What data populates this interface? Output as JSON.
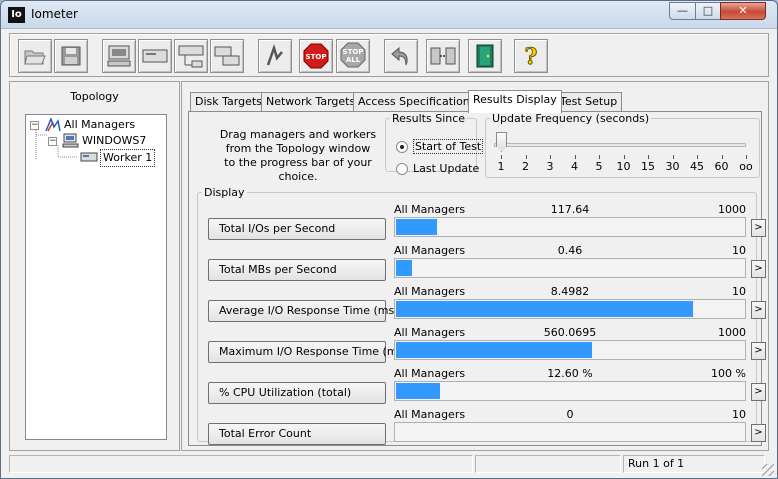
{
  "window": {
    "app_icon": "Io",
    "title": "Iometer",
    "controls": {
      "min": "—",
      "max": "□",
      "close": "✕"
    }
  },
  "toolbar": {
    "buttons": [
      {
        "name": "open-config-button",
        "icon": "folder-open-icon"
      },
      {
        "name": "save-config-button",
        "icon": "floppy-disk-icon"
      },
      {
        "name": "start-new-manager-button",
        "icon": "computer-icon"
      },
      {
        "name": "start-disk-worker-button",
        "icon": "disk-worker-icon"
      },
      {
        "name": "start-network-worker-button",
        "icon": "network-worker-icon"
      },
      {
        "name": "duplicate-worker-button",
        "icon": "duplicate-worker-icon"
      },
      {
        "name": "start-tests-button",
        "icon": "start-flag-icon"
      },
      {
        "name": "stop-button",
        "icon": "stop-sign-icon"
      },
      {
        "name": "stop-all-button",
        "icon": "stop-all-icon"
      },
      {
        "name": "reset-workers-button",
        "icon": "undo-arrow-icon"
      },
      {
        "name": "disconnect-manager-button",
        "icon": "disconnect-icon"
      },
      {
        "name": "exit-button",
        "icon": "exit-door-icon"
      },
      {
        "name": "about-button",
        "icon": "question-mark-icon"
      }
    ],
    "stop_text": "STOP",
    "stop_all_text_top": "STOP",
    "stop_all_text_bottom": "ALL",
    "help_text": "?"
  },
  "topology": {
    "header": "Topology",
    "items": [
      {
        "label": "All Managers",
        "expander": "−"
      },
      {
        "label": "WINDOWS7",
        "expander": "−"
      },
      {
        "label": "Worker 1"
      }
    ]
  },
  "tabs": [
    "Disk Targets",
    "Network Targets",
    "Access Specifications",
    "Results Display",
    "Test Setup"
  ],
  "active_tab": "Results Display",
  "instructions": {
    "line1": "Drag managers and workers",
    "line2": "from the Topology window",
    "line3": "to the progress bar of your choice."
  },
  "results_since": {
    "legend": "Results Since",
    "options": [
      {
        "label": "Start of Test",
        "checked": true
      },
      {
        "label": "Last Update",
        "checked": false
      }
    ]
  },
  "update_frequency": {
    "legend": "Update Frequency (seconds)",
    "ticks": [
      "1",
      "2",
      "3",
      "4",
      "5",
      "10",
      "15",
      "30",
      "45",
      "60",
      "oo"
    ],
    "selected": "1"
  },
  "display": {
    "legend": "Display",
    "arrow": ">",
    "metrics": [
      {
        "label": "Total I/Os per Second",
        "source": "All Managers",
        "value": "117.64",
        "max": "1000",
        "fraction": 0.1176
      },
      {
        "label": "Total MBs per Second",
        "source": "All Managers",
        "value": "0.46",
        "max": "10",
        "fraction": 0.046
      },
      {
        "label": "Average I/O Response Time (ms)",
        "source": "All Managers",
        "value": "8.4982",
        "max": "10",
        "fraction": 0.8498
      },
      {
        "label": "Maximum I/O Response Time (ms)",
        "source": "All Managers",
        "value": "560.0695",
        "max": "1000",
        "fraction": 0.5601
      },
      {
        "label": "% CPU Utilization (total)",
        "source": "All Managers",
        "value": "12.60 %",
        "max": "100 %",
        "fraction": 0.126
      },
      {
        "label": "Total Error Count",
        "source": "All Managers",
        "value": "0",
        "max": "10",
        "fraction": 0
      }
    ]
  },
  "status_bar": {
    "run_text": "Run 1 of 1"
  },
  "colors": {
    "bar_fill": "#3399ff",
    "close_button": "#c74a33"
  }
}
